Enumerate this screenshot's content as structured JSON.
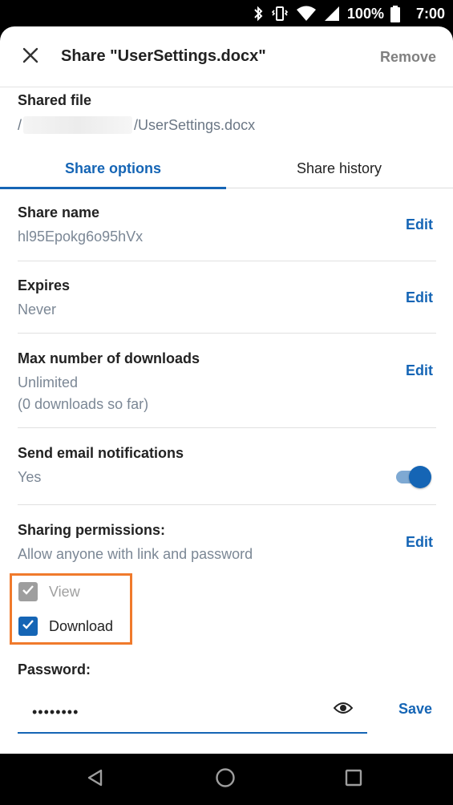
{
  "status_bar": {
    "battery": "100%",
    "time": "7:00"
  },
  "header": {
    "title": "Share \"UserSettings.docx\"",
    "remove_label": "Remove"
  },
  "shared_file": {
    "label": "Shared file",
    "path_prefix": "/",
    "path_file": "/UserSettings.docx"
  },
  "tabs": [
    {
      "label": "Share options",
      "active": true
    },
    {
      "label": "Share history",
      "active": false
    }
  ],
  "share_name": {
    "title": "Share name",
    "value": "hl95Epokg6o95hVx",
    "edit_label": "Edit"
  },
  "expires": {
    "title": "Expires",
    "value": "Never",
    "edit_label": "Edit"
  },
  "max_downloads": {
    "title": "Max number of downloads",
    "value": "Unlimited",
    "sub_value": "(0 downloads so far)",
    "edit_label": "Edit"
  },
  "email_notifications": {
    "title": "Send email notifications",
    "value": "Yes",
    "enabled": true
  },
  "permissions": {
    "title": "Sharing permissions:",
    "value": "Allow anyone with link and password",
    "edit_label": "Edit",
    "options": [
      {
        "label": "View",
        "checked": true,
        "disabled": true
      },
      {
        "label": "Download",
        "checked": true,
        "disabled": false
      }
    ]
  },
  "password": {
    "label": "Password:",
    "value": "••••••••",
    "save_label": "Save"
  },
  "colors": {
    "accent": "#1565b5",
    "highlight": "#f07a2c",
    "muted": "#7b8795"
  },
  "icons": [
    "bluetooth-icon",
    "vibrate-icon",
    "wifi-icon",
    "signal-icon",
    "battery-icon",
    "close-icon",
    "eye-icon",
    "back-nav-icon",
    "home-nav-icon",
    "recents-nav-icon"
  ]
}
